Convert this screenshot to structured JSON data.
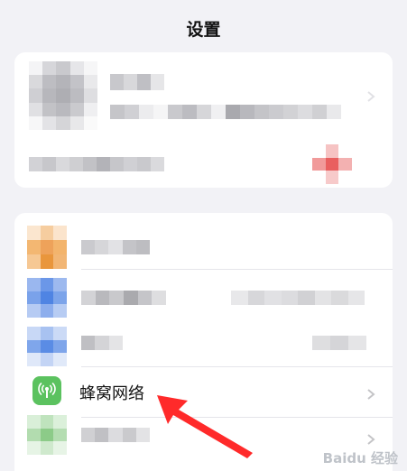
{
  "header": {
    "title": "设置"
  },
  "cellular": {
    "label": "蜂窝网络"
  },
  "colors": {
    "background": "#f2f2f6",
    "cellular_icon": "#5bc25f",
    "annotation_arrow": "#ff2a2a"
  },
  "icons": {
    "cellular": "antenna-icon",
    "chevron": "chevron-right-icon"
  },
  "watermark": {
    "text": "Baidu 经验"
  }
}
